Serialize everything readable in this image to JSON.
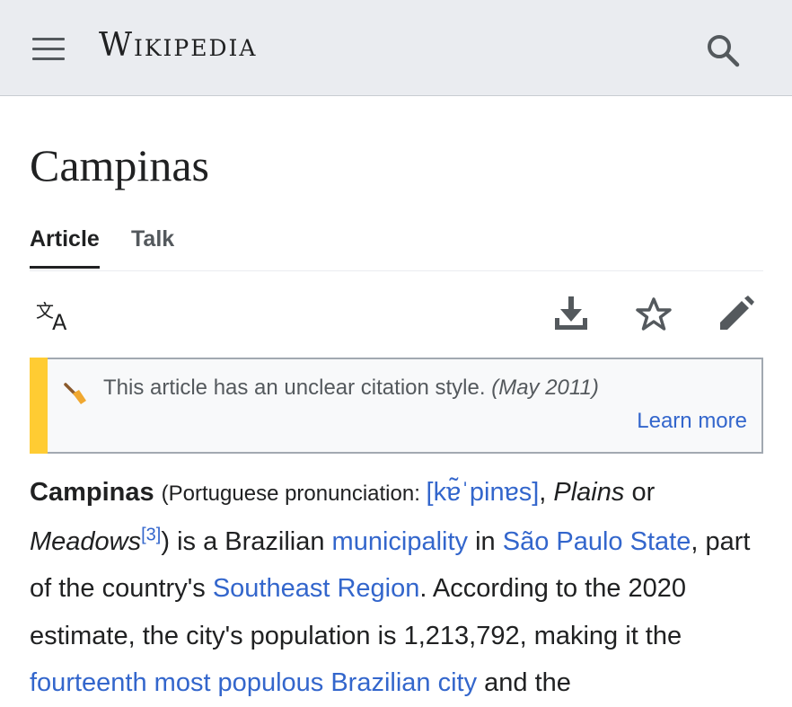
{
  "header": {
    "menu_icon": "hamburger-menu-icon",
    "logo_text": "Wikipedia",
    "search_icon": "search-icon"
  },
  "page": {
    "title": "Campinas"
  },
  "tabs": [
    {
      "label": "Article",
      "active": true
    },
    {
      "label": "Talk",
      "active": false
    }
  ],
  "toolbar": {
    "language_icon": "language-icon",
    "download_icon": "download-icon",
    "watch_icon": "star-icon",
    "edit_icon": "pencil-icon"
  },
  "notice": {
    "text": "This article has an unclear citation style.",
    "date": "(May 2011)",
    "learn_more": "Learn more",
    "accent_color": "#ffcc33"
  },
  "article": {
    "bold_name": "Campinas",
    "pron_prefix": "(Portuguese pronunciation: ",
    "ipa": "[kɐ̃ˈpinɐs]",
    "comma1": ", ",
    "meaning1": "Plains",
    "or": " or",
    "meaning2": "Meadows",
    "ref": "[3]",
    "t1": ") is a Brazilian ",
    "link_municipality": "municipality",
    "t2": " in ",
    "link_state": "São Paulo State",
    "t3": ", part of the country's ",
    "link_region": "Southeast Region",
    "t4": ". According to the 2020 estimate, the city's population is 1,213,792, making it the ",
    "link_rank": "fourteenth most populous Brazilian city",
    "t5": " and the"
  },
  "colors": {
    "link": "#3366cc",
    "header_bg": "#eaecf0",
    "text": "#202122"
  }
}
